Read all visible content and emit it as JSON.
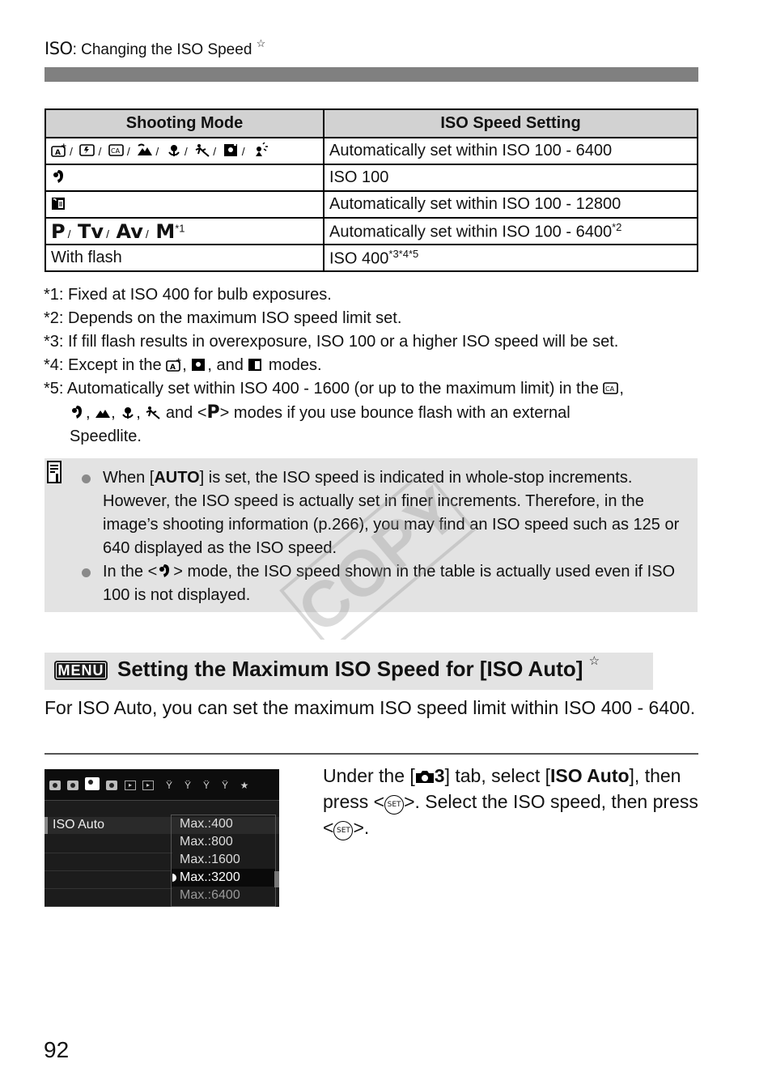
{
  "header": {
    "iso_glyph": "ISO",
    "title": ": Changing the ISO Speed",
    "star": "☆"
  },
  "table": {
    "headers": [
      "Shooting Mode",
      "ISO Speed Setting"
    ],
    "rows": [
      {
        "mode_icons": [
          "scene-intelligent-auto-icon",
          "flash-off-icon",
          "creative-auto-icon",
          "landscape-icon",
          "close-up-icon",
          "sports-icon",
          "night-portrait-icon",
          "hdr-backlight-icon"
        ],
        "mode_text": "",
        "setting": "Automatically set within ISO 100 - 6400",
        "setting_sup": ""
      },
      {
        "mode_icons": [
          "portrait-icon"
        ],
        "mode_text": "",
        "setting": "ISO 100",
        "setting_sup": ""
      },
      {
        "mode_icons": [
          "handheld-night-scene-icon"
        ],
        "mode_text": "",
        "setting": "Automatically set within ISO 100 - 12800",
        "setting_sup": ""
      },
      {
        "mode_icons": [],
        "mode_text": "P / Tv / Av / M",
        "mode_sup": "*1",
        "setting": "Automatically set within ISO 100 - 6400",
        "setting_sup": "*2"
      },
      {
        "mode_icons": [],
        "mode_text": "With flash",
        "setting": "ISO 400",
        "setting_sup": "*3*4*5"
      }
    ],
    "mode_labels": {
      "p": "P",
      "tv": "Tv",
      "av": "Av",
      "m": "M",
      "slash": "/"
    }
  },
  "footnotes": {
    "n1": "*1: Fixed at ISO 400 for bulb exposures.",
    "n2": "*2: Depends on the maximum ISO speed limit set.",
    "n3": "*3: If fill flash results in overexposure, ISO 100 or a higher ISO speed will be set.",
    "n4_a": "*4: Except in the ",
    "n4_b": ", ",
    "n4_c": ", and ",
    "n4_d": " modes.",
    "n5_a": "*5: Automatically set within ISO 400 - 1600 (or up to the maximum limit) in the ",
    "n5_b": ",",
    "n5_c": " and <",
    "n5_p": "P",
    "n5_d": "> modes if you use bounce flash with an external",
    "n5_e": "Speedlite.",
    "comma": ", "
  },
  "memo": {
    "b1_pre": "When [",
    "b1_bold": "AUTO",
    "b1_post": "] is set, the ISO speed is indicated in whole-stop increments. However, the ISO speed is actually set in finer increments. Therefore, in the image’s shooting information (p.266), you may find an ISO speed such as 125 or 640 displayed as the ISO speed.",
    "b2_pre": "In the <",
    "b2_post": "> mode, the ISO speed shown in the table is actually used even if ISO 100 is not displayed."
  },
  "watermark": "COPY",
  "section": {
    "menu_label": "MENU",
    "title": "Setting the Maximum ISO Speed for [ISO Auto]",
    "star": "☆"
  },
  "intro": "For ISO Auto, you can set the maximum ISO speed limit within ISO 400 - 6400.",
  "lcd": {
    "menu_item": "ISO Auto",
    "options": [
      "Max.:400",
      "Max.:800",
      "Max.:1600",
      "Max.:3200",
      "Max.:6400"
    ],
    "selected_index": 3
  },
  "steps": {
    "p1": "Under the [",
    "tab_num": "3",
    "p2": "] tab, select [",
    "bold": "ISO Auto",
    "p3": "], then press <",
    "set": "SET",
    "p4": ">. Select the ISO speed, then press <",
    "p5": ">."
  },
  "page_number": "92"
}
